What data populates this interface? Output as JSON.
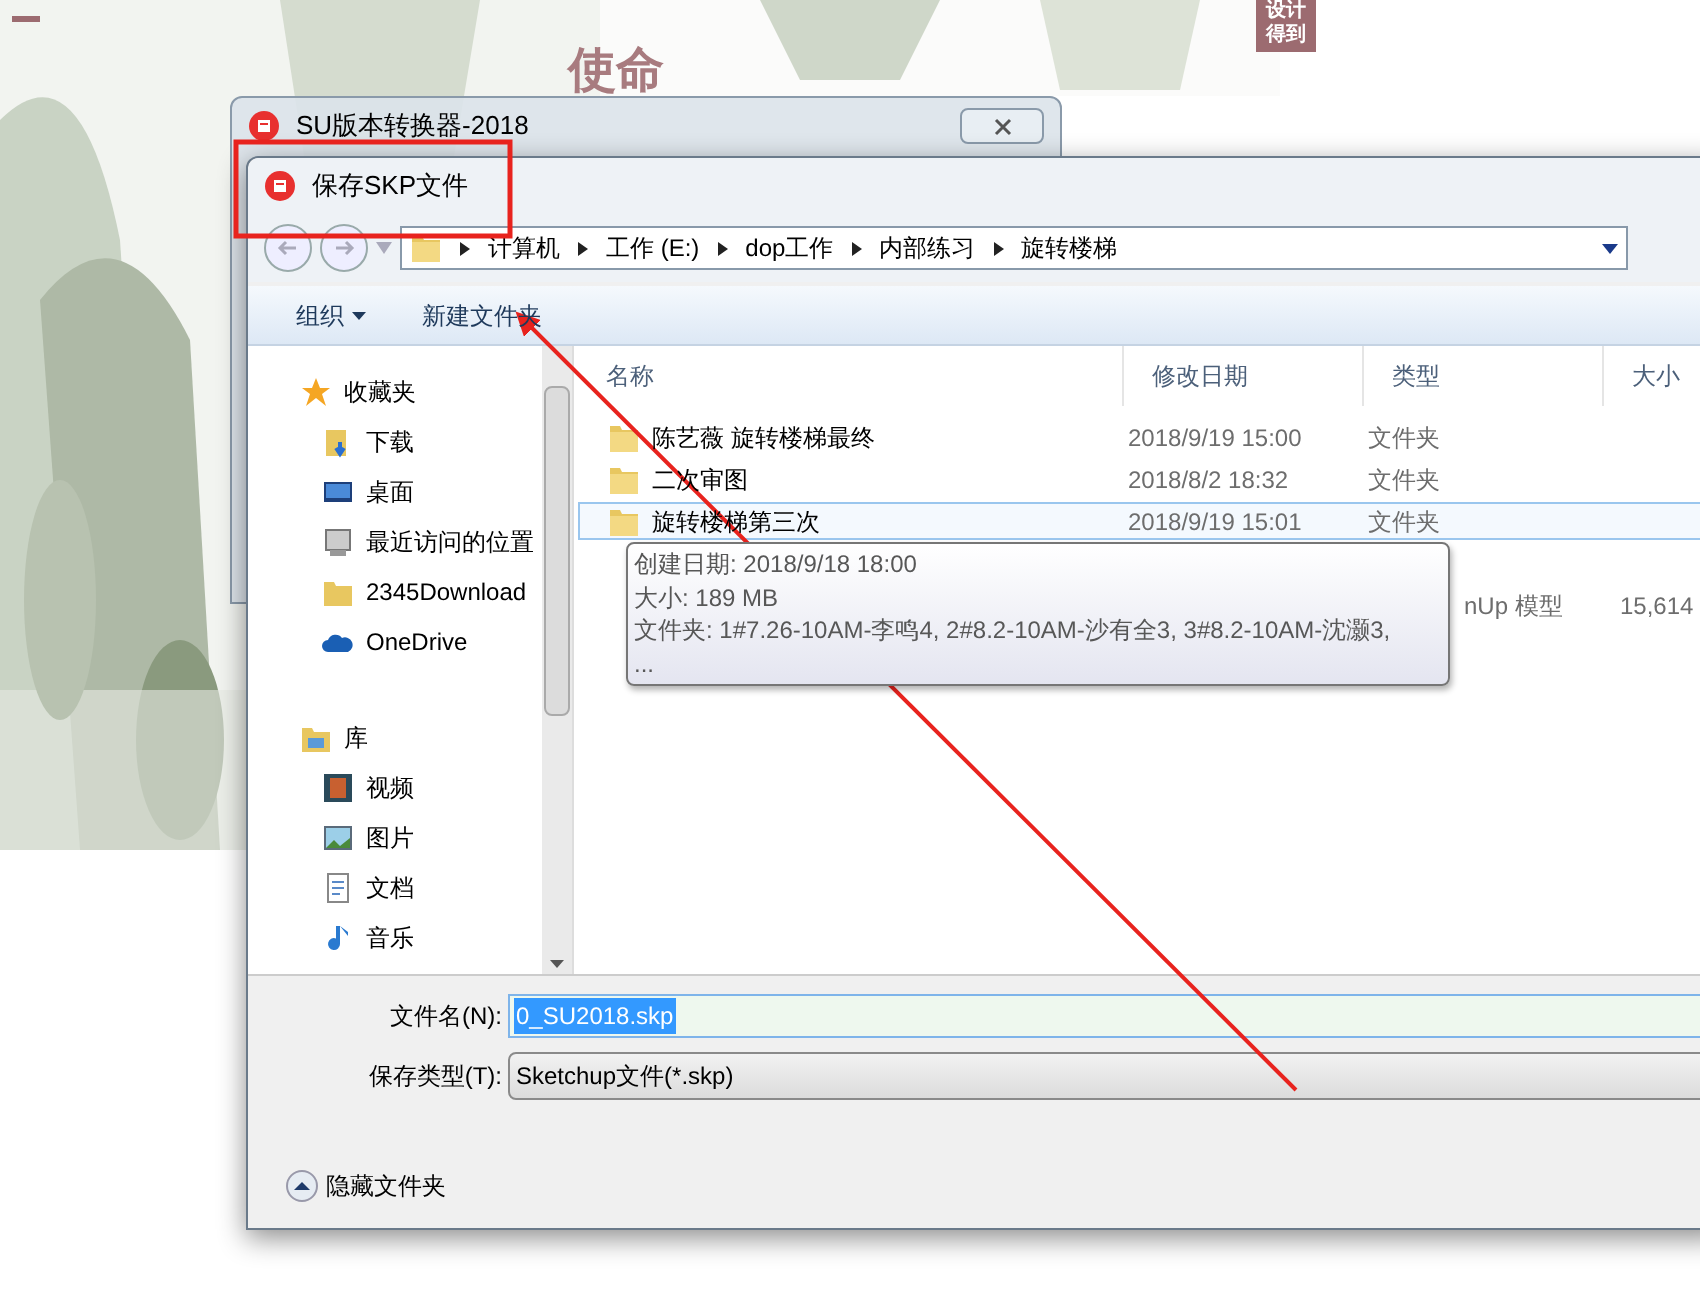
{
  "background": {
    "heading": "使命",
    "logo": "设计得到"
  },
  "back_window": {
    "title": "SU版本转换器-2018"
  },
  "dialog": {
    "title": "保存SKP文件",
    "breadcrumb": [
      "计算机",
      "工作 (E:)",
      "dop工作",
      "内部练习",
      "旋转楼梯"
    ],
    "toolbar": [
      {
        "label": "组织",
        "dropdown": true
      },
      {
        "label": "新建文件夹",
        "dropdown": false
      }
    ],
    "sidebar": [
      {
        "label": "收藏夹",
        "kind": "star",
        "children": [
          {
            "label": "下载",
            "kind": "download"
          },
          {
            "label": "桌面",
            "kind": "desktop"
          },
          {
            "label": "最近访问的位置",
            "kind": "recent"
          },
          {
            "label": "2345Download",
            "kind": "folder"
          },
          {
            "label": "OneDrive",
            "kind": "cloud"
          }
        ]
      },
      {
        "label": "库",
        "kind": "library",
        "children": [
          {
            "label": "视频",
            "kind": "video"
          },
          {
            "label": "图片",
            "kind": "picture"
          },
          {
            "label": "文档",
            "kind": "document"
          },
          {
            "label": "音乐",
            "kind": "music"
          }
        ]
      }
    ],
    "columns": [
      "名称",
      "修改日期",
      "类型",
      "大小"
    ],
    "rows": [
      {
        "name": "陈艺薇 旋转楼梯最终",
        "date": "2018/9/19 15:00",
        "type": "文件夹",
        "hovered": false
      },
      {
        "name": "二次审图",
        "date": "2018/8/2 18:32",
        "type": "文件夹",
        "hovered": false
      },
      {
        "name": "旋转楼梯第三次",
        "date": "2018/9/19 15:01",
        "type": "文件夹",
        "hovered": true
      },
      {
        "type": "nUp 模型",
        "size": "15,614",
        "hovered": false
      }
    ],
    "tooltip": [
      "创建日期: 2018/9/18 18:00",
      "大小: 189 MB",
      "文件夹: 1#7.26-10AM-李鸣4, 2#8.2-10AM-沙有全3, 3#8.2-10AM-沈灏3,",
      "..."
    ],
    "filename": {
      "label": "文件名(N):",
      "value": "0_SU2018.skp"
    },
    "file_type": {
      "label": "保存类型(T):",
      "value": "Sketchup文件(*.skp)"
    },
    "hide_folders": "隐藏文件夹"
  }
}
